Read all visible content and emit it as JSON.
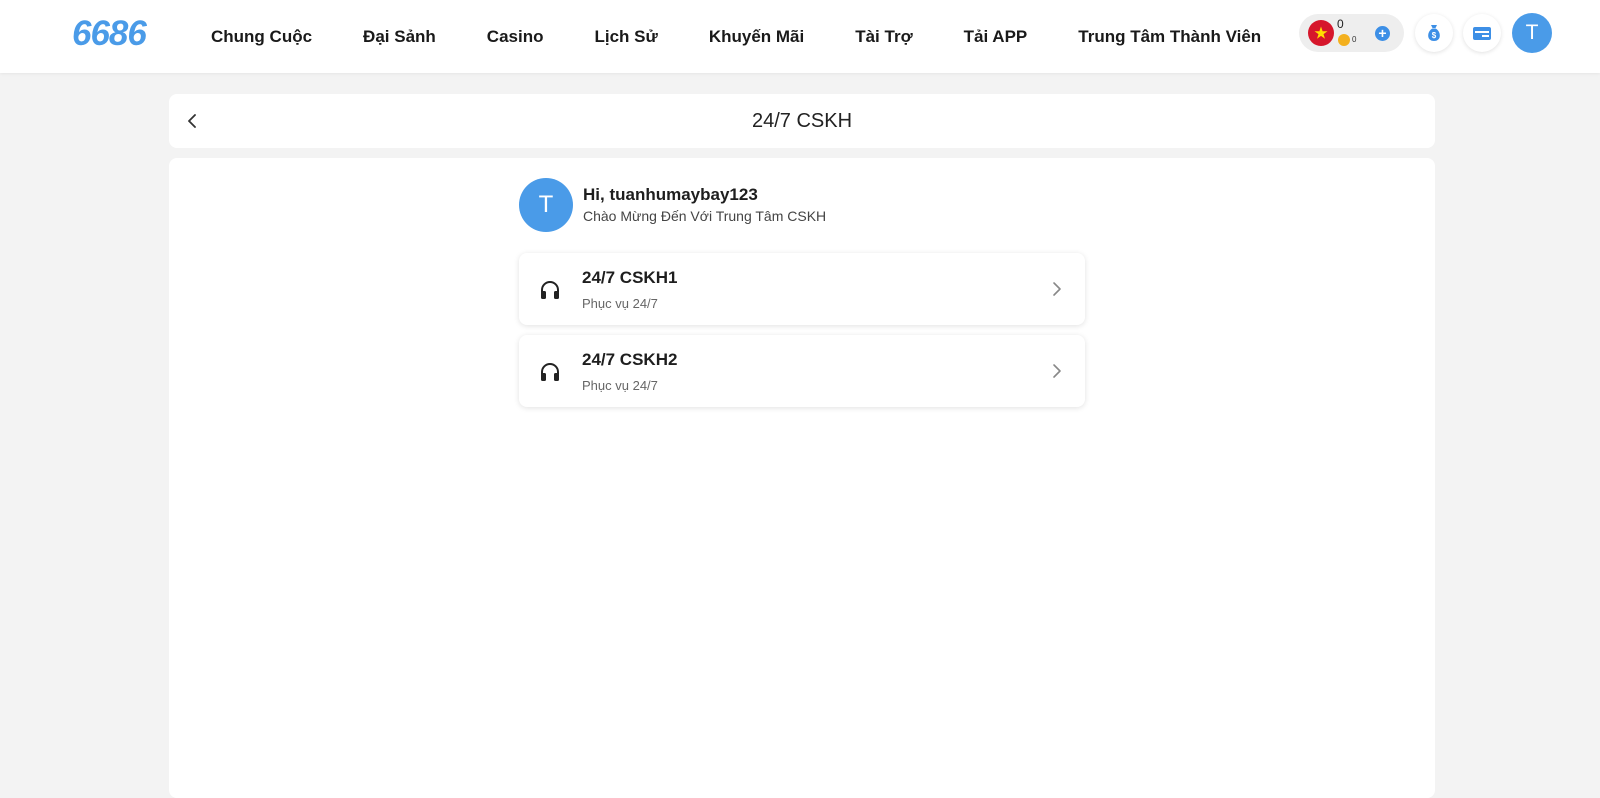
{
  "header": {
    "logo": "6686",
    "nav": [
      {
        "label": "Chung Cuộc"
      },
      {
        "label": "Đại Sảnh"
      },
      {
        "label": "Casino"
      },
      {
        "label": "Lịch Sử"
      },
      {
        "label": "Khuyến Mãi"
      },
      {
        "label": "Tài Trợ"
      },
      {
        "label": "Tải APP"
      },
      {
        "label": "Trung Tâm Thành Viên"
      }
    ],
    "wallet": {
      "balance": "0",
      "coin_balance": "0",
      "plus": "+"
    },
    "avatar_initial": "T"
  },
  "page": {
    "title": "24/7 CSKH"
  },
  "greeting": {
    "avatar_initial": "T",
    "title": "Hi, tuanhumaybay123",
    "subtitle": "Chào Mừng Đến Với Trung Tâm CSKH"
  },
  "services": [
    {
      "name": "24/7 CSKH1",
      "desc": "Phục vụ 24/7"
    },
    {
      "name": "24/7 CSKH2",
      "desc": "Phục vụ 24/7"
    }
  ],
  "colors": {
    "brand": "#4a9be8",
    "background": "#f3f3f3",
    "flag_red": "#d6162b",
    "coin": "#f3b01e"
  },
  "icons": {
    "flag": "vietnam-flag-icon",
    "coin": "coin-icon",
    "plus": "plus-icon",
    "money_bag": "money-bag-icon",
    "card": "card-icon",
    "back": "chevron-left-icon",
    "service": "headphones-icon",
    "chevron": "chevron-right-icon"
  }
}
